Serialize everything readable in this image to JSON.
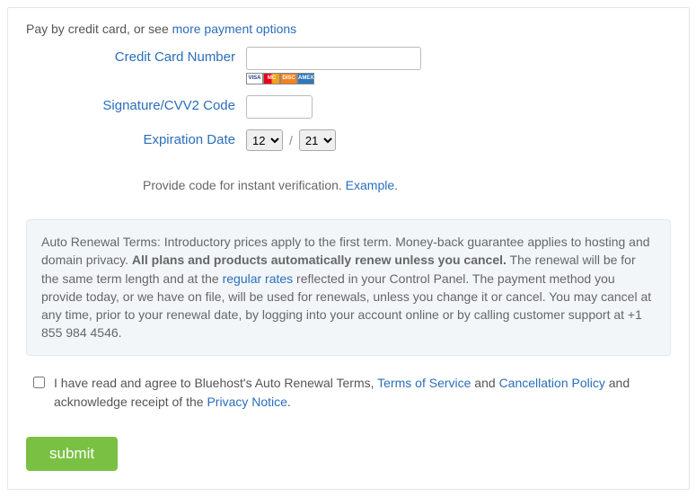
{
  "intro": {
    "prefix": "Pay by credit card, or see ",
    "link": "more payment options"
  },
  "form": {
    "cc_label": "Credit Card Number",
    "cc_value": "",
    "cvv_label": "Signature/CVV2 Code",
    "cvv_value": "",
    "exp_label": "Expiration Date",
    "exp_month": "12",
    "exp_year": "21",
    "slash": "/",
    "cards": [
      "VISA",
      "MC",
      "DISC",
      "AMEX"
    ]
  },
  "verify": {
    "text": "Provide code for instant verification. ",
    "link": "Example",
    "dot": "."
  },
  "terms": {
    "t1": "Auto Renewal Terms: Introductory prices apply to the first term. Money-back guarantee applies to hosting and domain privacy. ",
    "bold": "All plans and products automatically renew unless you cancel.",
    "t2": " The renewal will be for the same term length and at the ",
    "rates_link": "regular rates",
    "t3": " reflected in your Control Panel. The payment method you provide today, or we have on file, will be used for renewals, unless you change it or cancel. You may cancel at any time, prior to your renewal date, by logging into your account online or by calling customer support at +1 855 984 4546."
  },
  "consent": {
    "p1": "I have read and agree to Bluehost's Auto Renewal Terms, ",
    "tos": "Terms of Service",
    "and1": " and ",
    "cancel": "Cancellation Policy",
    "p2": " and acknowledge receipt of the ",
    "privacy": "Privacy Notice",
    "dot": "."
  },
  "submit_label": "submit"
}
